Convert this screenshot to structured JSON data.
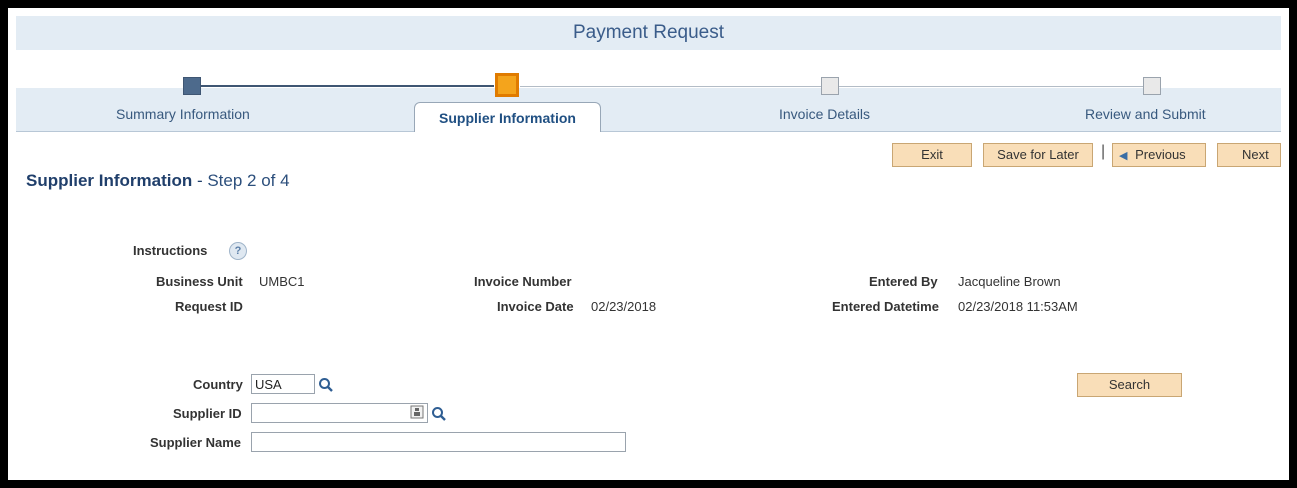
{
  "header": {
    "title": "Payment Request"
  },
  "train": {
    "steps": [
      {
        "label": "Summary Information",
        "state": "done"
      },
      {
        "label": "Supplier Information",
        "state": "current"
      },
      {
        "label": "Invoice Details",
        "state": "todo"
      },
      {
        "label": "Review and Submit",
        "state": "todo"
      }
    ]
  },
  "toolbar": {
    "exit_label": "Exit",
    "save_later_label": "Save for Later",
    "separator": "|",
    "previous_label": "Previous",
    "next_label": "Next"
  },
  "page": {
    "title": "Supplier Information",
    "dash": " - ",
    "step_text": "Step 2 of 4"
  },
  "info": {
    "instructions_label": "Instructions",
    "help_glyph": "?",
    "business_unit_label": "Business Unit",
    "business_unit_value": "UMBC1",
    "request_id_label": "Request ID",
    "request_id_value": "",
    "invoice_number_label": "Invoice Number",
    "invoice_number_value": "",
    "invoice_date_label": "Invoice Date",
    "invoice_date_value": "02/23/2018",
    "entered_by_label": "Entered By",
    "entered_by_value": "Jacqueline Brown",
    "entered_datetime_label": "Entered Datetime",
    "entered_datetime_value": "02/23/2018 11:53AM"
  },
  "form": {
    "country_label": "Country",
    "country_value": "USA",
    "supplier_id_label": "Supplier ID",
    "supplier_id_value": "",
    "supplier_name_label": "Supplier Name",
    "supplier_name_value": "",
    "search_label": "Search"
  },
  "colors": {
    "accent": "#f4a41c",
    "band": "#e3ecf4",
    "button": "#f9deb8",
    "title_text": "#203f6b"
  },
  "icons": [
    "help-icon",
    "magnifier-icon",
    "chevron-left-icon",
    "lookup-icon"
  ]
}
